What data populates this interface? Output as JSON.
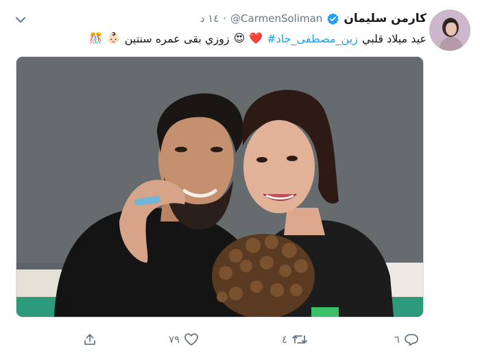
{
  "tweet": {
    "display_name": "كارمن سليمان",
    "handle": "@CarmenSoliman",
    "separator": "·",
    "time": "١٤ د",
    "text": {
      "part1": "عيد ميلاد قلبي",
      "hashtag": "#زين_مصطفى_جاد",
      "emoji1": "❤️",
      "emoji2": "😍",
      "part2": "زوزي بقى عمره سنتين",
      "emoji3": "👶🏻",
      "emoji4": "🎊"
    }
  },
  "actions": {
    "reply_count": "٦",
    "retweet_count": "٤",
    "like_count": "٧٩"
  },
  "colors": {
    "link": "#1da1f2",
    "muted": "#657786",
    "text": "#14171a",
    "verified": "#1da1f2"
  },
  "icons": [
    "chevron-down-icon",
    "verified-badge-icon",
    "reply-icon",
    "retweet-icon",
    "like-icon",
    "share-icon"
  ]
}
